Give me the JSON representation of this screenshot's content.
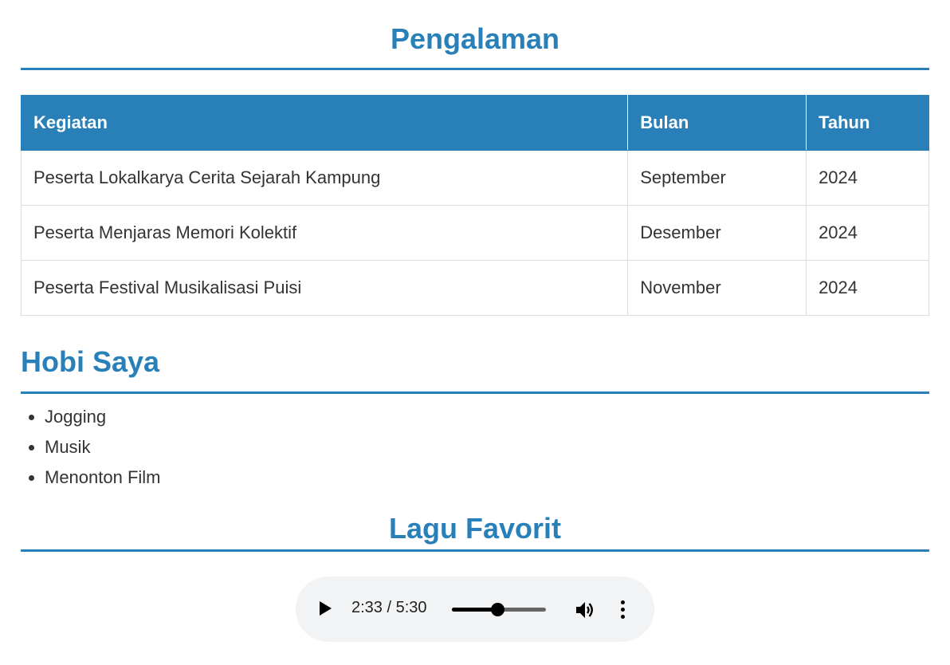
{
  "pengalaman": {
    "title": "Pengalaman",
    "table": {
      "headers": [
        "Kegiatan",
        "Bulan",
        "Tahun"
      ],
      "rows": [
        [
          "Peserta Lokalkarya Cerita Sejarah Kampung",
          "September",
          "2024"
        ],
        [
          "Peserta Menjaras Memori Kolektif",
          "Desember",
          "2024"
        ],
        [
          "Peserta Festival Musikalisasi Puisi",
          "November",
          "2024"
        ]
      ]
    }
  },
  "hobi": {
    "title": "Hobi Saya",
    "items": [
      "Jogging",
      "Musik",
      "Menonton Film"
    ]
  },
  "lagu": {
    "title": "Lagu Favorit",
    "player": {
      "current_time": "2:33",
      "separator": " / ",
      "duration": "5:30",
      "progress": 0.4818
    }
  },
  "colors": {
    "accent": "#2980b9",
    "text": "#333333",
    "border": "#dddddd",
    "player_bg": "#f1f3f4"
  },
  "icons": [
    "play-icon",
    "volume-icon",
    "more-options-icon"
  ]
}
